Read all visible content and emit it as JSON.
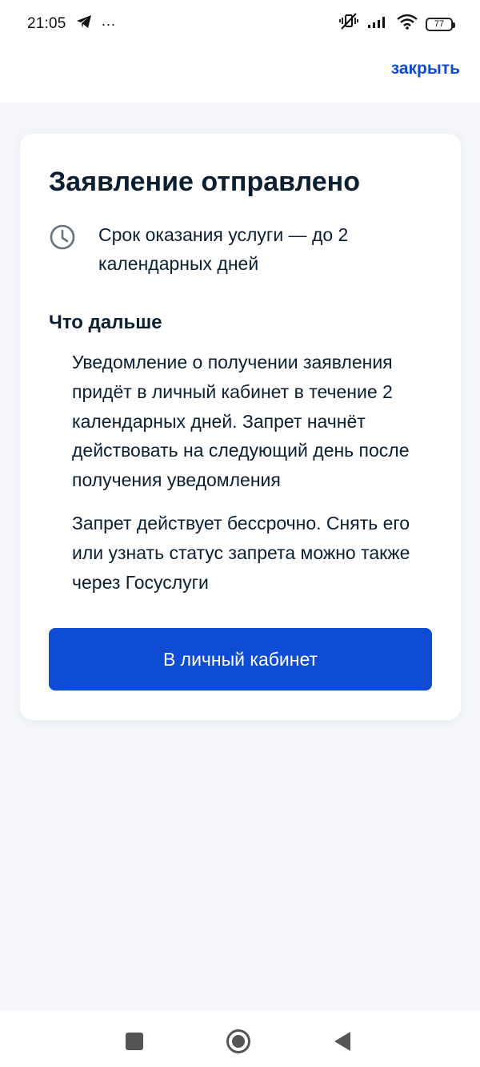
{
  "status_bar": {
    "time": "21:05",
    "more_indicator": "···",
    "battery_level": "77",
    "icons": [
      "telegram-icon",
      "mute-vibrate-icon",
      "signal-icon",
      "wifi-icon",
      "battery-icon"
    ]
  },
  "header": {
    "close_label": "закрыть"
  },
  "card": {
    "title": "Заявление отправлено",
    "term_icon": "clock-icon",
    "term_text": "Срок оказания услуги — до 2 календарных дней",
    "next_title": "Что дальше",
    "next_paragraphs": [
      "Уведомление о получении заявления придёт в личный кабинет в течение 2 календарных дней. Запрет начнёт действовать на следующий день после получения уведомления",
      "Запрет действует бессрочно. Снять его или узнать статус запрета можно также через Госуслуги"
    ],
    "button_label": "В личный кабинет"
  },
  "nav_bar": {
    "icons": [
      "recent-apps-icon",
      "home-icon",
      "back-icon"
    ]
  },
  "colors": {
    "accent": "#0d4cd3",
    "text": "#0b1f33",
    "background": "#f5f7fb",
    "card": "#ffffff"
  }
}
